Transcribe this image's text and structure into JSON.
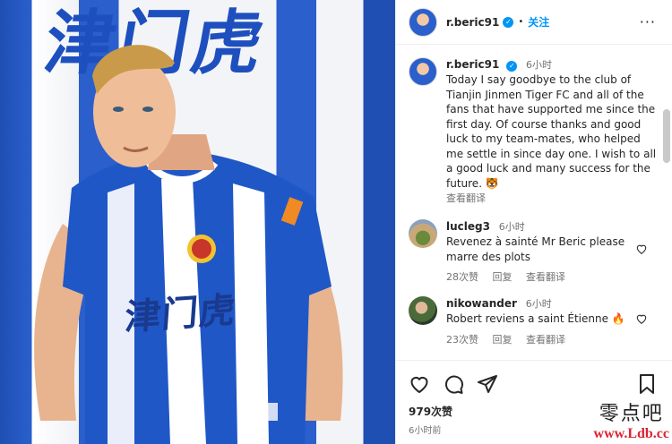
{
  "photo": {
    "bg_text": "津门虎",
    "jersey_text": "津门虎"
  },
  "header": {
    "username": "r.beric91",
    "verified": "✓",
    "separator": "•",
    "follow_label": "关注",
    "more_label": "···"
  },
  "caption": {
    "username": "r.beric91",
    "time": "6小时",
    "text": "Today I say goodbye to the club of Tianjin Jinmen Tiger FC and all of the fans that have supported me since the first day. Of course thanks and good luck to my team-mates, who helped me settle in since day one. I wish to all a good luck and many success for the future. 🐯",
    "translate": "查看翻译"
  },
  "comments": [
    {
      "username": "lucleg3",
      "time": "6小时",
      "text": "Revenez à sainté Mr Beric please marre des plots",
      "likes": "28次赞",
      "reply": "回复",
      "translate": "查看翻译"
    },
    {
      "username": "nikowander",
      "time": "6小时",
      "text": "Robert reviens a saint Étienne 🔥",
      "likes": "23次赞",
      "reply": "回复",
      "translate": "查看翻译"
    }
  ],
  "actions": {
    "likes": "979次赞",
    "time": "6小时前"
  },
  "watermark": {
    "line1": "零点吧",
    "line2": "www.Ldb.cc"
  },
  "colors": {
    "accent": "#0095f6",
    "brand_blue": "#2a5fcc"
  }
}
